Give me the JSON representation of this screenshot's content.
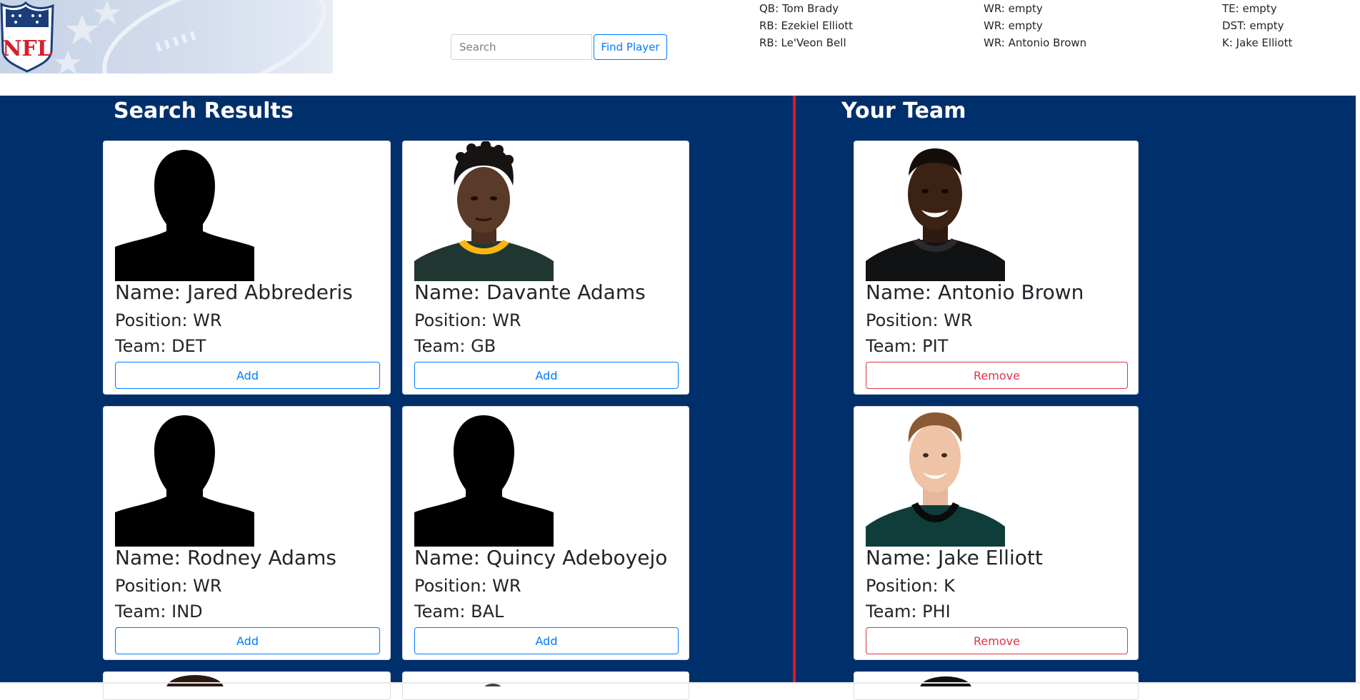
{
  "header": {
    "logo_text": "NFL",
    "search": {
      "placeholder": "Search",
      "value": ""
    },
    "find_button_label": "Find Player",
    "roster": [
      {
        "slot": "QB",
        "player": "Tom Brady"
      },
      {
        "slot": "RB",
        "player": "Ezekiel Elliott"
      },
      {
        "slot": "RB",
        "player": "Le'Veon Bell"
      },
      {
        "slot": "WR",
        "player": "empty"
      },
      {
        "slot": "WR",
        "player": "empty"
      },
      {
        "slot": "WR",
        "player": "Antonio Brown"
      },
      {
        "slot": "TE",
        "player": "empty"
      },
      {
        "slot": "DST",
        "player": "empty"
      },
      {
        "slot": "K",
        "player": "Jake Elliott"
      }
    ]
  },
  "search_results": {
    "title": "Search Results",
    "players": [
      {
        "name_label": "Name: Jared Abbrederis",
        "position_label": "Position: WR",
        "team_label": "Team: DET",
        "action_label": "Add",
        "photo": "silhouette-icon"
      },
      {
        "name_label": "Name: Davante Adams",
        "position_label": "Position: WR",
        "team_label": "Team: GB",
        "action_label": "Add",
        "photo": "player-photo-green-jersey"
      },
      {
        "name_label": "Name: Rodney Adams",
        "position_label": "Position: WR",
        "team_label": "Team: IND",
        "action_label": "Add",
        "photo": "silhouette-icon"
      },
      {
        "name_label": "Name: Quincy Adeboyejo",
        "position_label": "Position: WR",
        "team_label": "Team: BAL",
        "action_label": "Add",
        "photo": "silhouette-icon"
      }
    ]
  },
  "your_team": {
    "title": "Your Team",
    "players": [
      {
        "name_label": "Name: Antonio Brown",
        "position_label": "Position: WR",
        "team_label": "Team: PIT",
        "action_label": "Remove",
        "photo": "player-photo-dark-jersey"
      },
      {
        "name_label": "Name: Jake Elliott",
        "position_label": "Position: K",
        "team_label": "Team: PHI",
        "action_label": "Remove",
        "photo": "player-photo-midnight-green-jersey"
      }
    ]
  },
  "colors": {
    "background": "#00306b",
    "divider": "#e8141e",
    "add_button": "#007bff",
    "remove_button": "#dc3545"
  }
}
